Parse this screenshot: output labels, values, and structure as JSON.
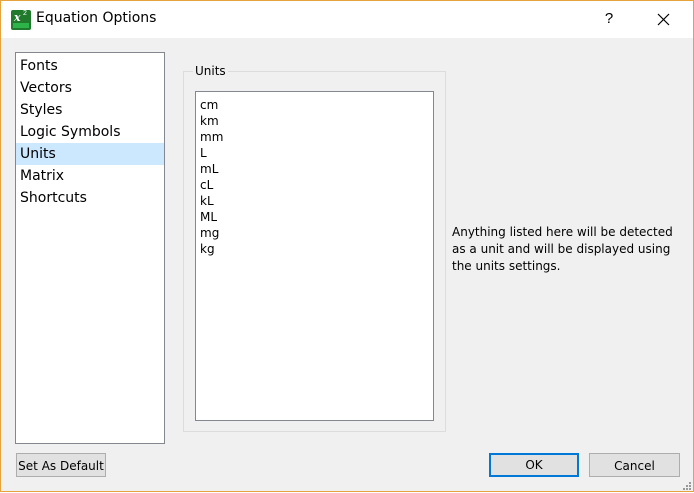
{
  "window": {
    "title": "Equation Options",
    "help_glyph": "?",
    "border_color": "#e6a23c"
  },
  "nav": {
    "items": [
      {
        "label": "Fonts",
        "selected": false
      },
      {
        "label": "Vectors",
        "selected": false
      },
      {
        "label": "Styles",
        "selected": false
      },
      {
        "label": "Logic Symbols",
        "selected": false
      },
      {
        "label": "Units",
        "selected": true
      },
      {
        "label": "Matrix",
        "selected": false
      },
      {
        "label": "Shortcuts",
        "selected": false
      }
    ],
    "selected_color": "#cce8ff"
  },
  "units": {
    "group_label": "Units",
    "values": [
      "cm",
      "km",
      "mm",
      "L",
      "mL",
      "cL",
      "kL",
      "ML",
      "mg",
      "kg"
    ]
  },
  "info": {
    "text": "Anything listed here will be detected as a unit and will be displayed using the units settings."
  },
  "buttons": {
    "set_default": "Set As Default",
    "ok": "OK",
    "cancel": "Cancel"
  },
  "icons": {
    "app": "app-equation-icon",
    "close": "close-icon",
    "help": "help-icon",
    "grip": "resize-grip-icon"
  }
}
